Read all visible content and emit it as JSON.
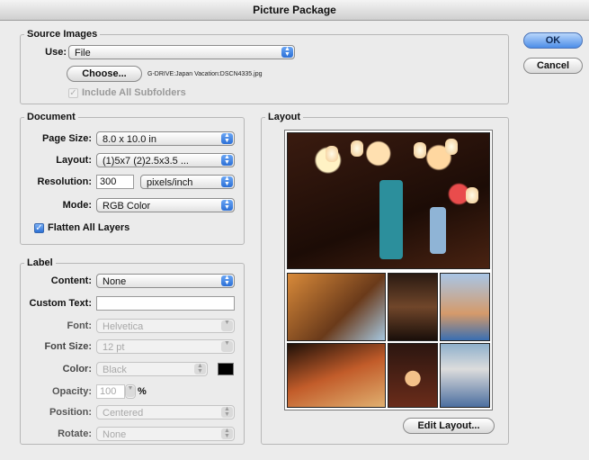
{
  "window": {
    "title": "Picture Package"
  },
  "buttons": {
    "ok": "OK",
    "cancel": "Cancel"
  },
  "source_images": {
    "legend": "Source Images",
    "use_label": "Use:",
    "use_value": "File",
    "choose_label": "Choose...",
    "file_path": "G-DRIVE:Japan Vacation:DSCN4335.jpg",
    "include_subfolders_label": "Include All Subfolders",
    "include_subfolders_checked": true,
    "include_subfolders_enabled": false
  },
  "document": {
    "legend": "Document",
    "page_size_label": "Page Size:",
    "page_size_value": "8.0 x 10.0 in",
    "layout_label": "Layout:",
    "layout_value": "(1)5x7 (2)2.5x3.5 ...",
    "resolution_label": "Resolution:",
    "resolution_value": "300",
    "resolution_unit": "pixels/inch",
    "mode_label": "Mode:",
    "mode_value": "RGB Color",
    "flatten_label": "Flatten All Layers",
    "flatten_checked": true
  },
  "label_group": {
    "legend": "Label",
    "content_label": "Content:",
    "content_value": "None",
    "custom_text_label": "Custom Text:",
    "custom_text_value": "",
    "font_label": "Font:",
    "font_value": "Helvetica",
    "font_size_label": "Font Size:",
    "font_size_value": "12 pt",
    "color_label": "Color:",
    "color_value": "Black",
    "color_swatch": "#000000",
    "opacity_label": "Opacity:",
    "opacity_value": "100",
    "opacity_unit": "%",
    "position_label": "Position:",
    "position_value": "Centered",
    "rotate_label": "Rotate:",
    "rotate_value": "None"
  },
  "layout_preview": {
    "legend": "Layout",
    "edit_layout_label": "Edit Layout..."
  },
  "icons": {
    "popup_arrows": "up-down-arrows-icon",
    "checkmark": "checkmark-icon",
    "stepper": "stepper-arrow-icon"
  },
  "colors": {
    "accent": "#2b6fd6",
    "default_button": "#4d8ee8"
  }
}
